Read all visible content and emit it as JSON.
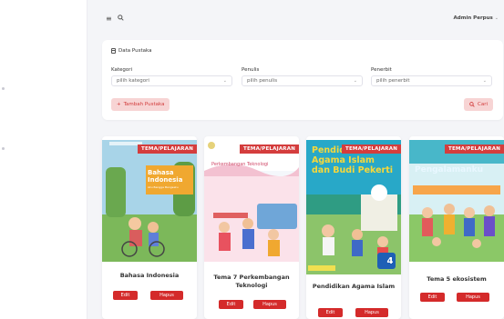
{
  "header": {
    "admin_label": "Admin Perpus"
  },
  "panel": {
    "title": "Data Pustaka",
    "filters": [
      {
        "label": "Kategori",
        "value": "pilih kategori"
      },
      {
        "label": "Penulis",
        "value": "pilih penulis"
      },
      {
        "label": "Penerbit",
        "value": "pilih penerbit"
      }
    ],
    "add_label": "Tambah Pustaka",
    "search_label": "Cari"
  },
  "books": [
    {
      "category": "TEMA/PELAJARAN",
      "title": "Bahasa Indonesia",
      "cover_title": "Bahasa Indonesia",
      "cover_subtitle": "Aku Bangga Bangsaku",
      "edit_label": "Edit",
      "delete_label": "Hapus"
    },
    {
      "category": "TEMA/PELAJARAN",
      "title": "Tema 7 Perkembangan Teknologi",
      "cover_title": "Perkembangan Teknologi",
      "edit_label": "Edit",
      "delete_label": "Hapus"
    },
    {
      "category": "TEMA/PELAJARAN",
      "title": "Pendidikan Agama Islam",
      "cover_title": "Pendidikan Agama Islam dan Budi Pekerti",
      "cover_number": "4",
      "edit_label": "Edit",
      "delete_label": "Hapus"
    },
    {
      "category": "TEMA/PELAJARAN",
      "title": "Tema 5 ekosistem",
      "cover_title": "Pengalamanku",
      "edit_label": "Edit",
      "delete_label": "Hapus"
    }
  ],
  "colors": {
    "accent": "#d42a2a",
    "badge": "#d43d3d",
    "soft_accent": "#f7d4d4"
  }
}
